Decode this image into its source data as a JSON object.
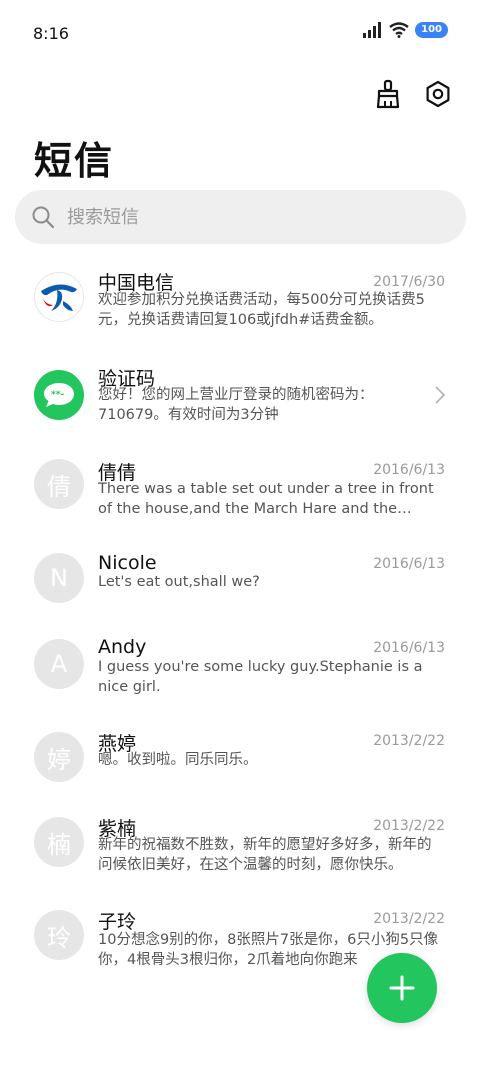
{
  "status_bar": {
    "time": "8:16",
    "battery": "100"
  },
  "header": {
    "title": "短信"
  },
  "search": {
    "placeholder": "搜索短信"
  },
  "conversations": [
    {
      "name": "中国电信",
      "date": "2017/6/30",
      "preview": "欢迎参加积分兑换话费活动，每500分可兑换话费5元，兑换话费请回复106或jfdh#话费金额。",
      "avatar_icon": "china-telecom-logo"
    },
    {
      "name": "验证码",
      "date": "",
      "preview": "您好！您的网上营业厅登录的随机密码为：710679。有效时间为3分钟",
      "avatar_icon": "message-code-icon"
    },
    {
      "name": "倩倩",
      "date": "2016/6/13",
      "preview": "There was a table set out under a tree in front of the house,and the March Hare and the Hatter were having tea at it.",
      "avatar_text": "倩"
    },
    {
      "name": "Nicole",
      "date": "2016/6/13",
      "preview": "Let's eat out,shall we?",
      "avatar_text": "N"
    },
    {
      "name": "Andy",
      "date": "2016/6/13",
      "preview": "I guess you're some lucky guy.Stephanie is a nice girl.",
      "avatar_text": "A"
    },
    {
      "name": "燕婷",
      "date": "2013/2/22",
      "preview": "嗯。收到啦。同乐同乐。",
      "avatar_text": "婷"
    },
    {
      "name": "紫楠",
      "date": "2013/2/22",
      "preview": "新年的祝福数不胜数，新年的愿望好多好多，新年的问候依旧美好，在这个温馨的时刻，愿你快乐。",
      "avatar_text": "楠"
    },
    {
      "name": "子玲",
      "date": "2013/2/22",
      "preview": "10分想念9别的你，8张照片7张是你，6只小狗5只像你，4根骨头3根归你，2爪着地向你跑来",
      "avatar_text": "玲"
    }
  ],
  "colors": {
    "accent_green": "#22c55e",
    "battery_blue": "#3b82f6"
  }
}
